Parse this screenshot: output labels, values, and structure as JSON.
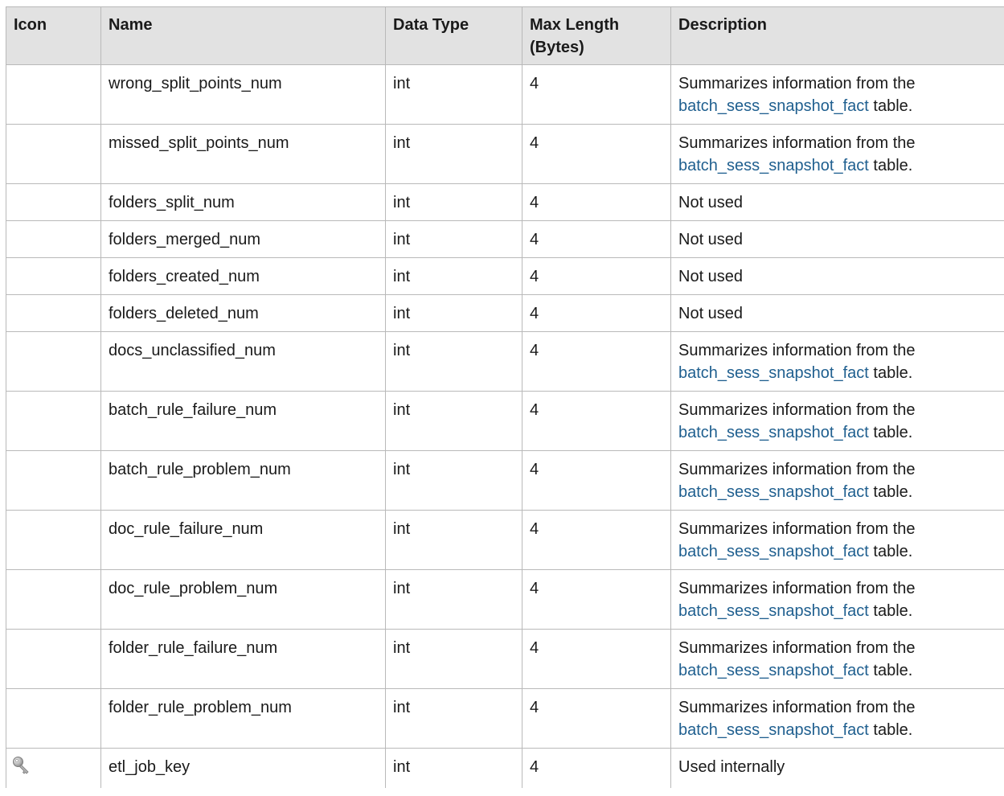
{
  "columns": [
    "Icon",
    "Name",
    "Data Type",
    "Max Length (Bytes)",
    "Description"
  ],
  "header": {
    "icon": "Icon",
    "name": "Name",
    "data_type": "Data Type",
    "max_length_line1": "Max Length",
    "max_length_line2": "(Bytes)",
    "description": "Description"
  },
  "rows": [
    {
      "icon": "",
      "name": "wrong_split_points_num",
      "type": "int",
      "length": "4",
      "desc_prefix": "Summarizes information from the",
      "desc_link": "batch_sess_snapshot_fact",
      "desc_suffix": " table."
    },
    {
      "icon": "",
      "name": "missed_split_points_num",
      "type": "int",
      "length": "4",
      "desc_prefix": "Summarizes information from the",
      "desc_link": "batch_sess_snapshot_fact",
      "desc_suffix": " table."
    },
    {
      "icon": "",
      "name": "folders_split_num",
      "type": "int",
      "length": "4",
      "desc_text": "Not used"
    },
    {
      "icon": "",
      "name": "folders_merged_num",
      "type": "int",
      "length": "4",
      "desc_text": "Not used"
    },
    {
      "icon": "",
      "name": "folders_created_num",
      "type": "int",
      "length": "4",
      "desc_text": "Not used"
    },
    {
      "icon": "",
      "name": "folders_deleted_num",
      "type": "int",
      "length": "4",
      "desc_text": "Not used"
    },
    {
      "icon": "",
      "name": "docs_unclassified_num",
      "type": "int",
      "length": "4",
      "desc_prefix": "Summarizes information from the",
      "desc_link": "batch_sess_snapshot_fact",
      "desc_suffix": " table."
    },
    {
      "icon": "",
      "name": "batch_rule_failure_num",
      "type": "int",
      "length": "4",
      "desc_prefix": "Summarizes information from the",
      "desc_link": "batch_sess_snapshot_fact",
      "desc_suffix": " table."
    },
    {
      "icon": "",
      "name": "batch_rule_problem_num",
      "type": "int",
      "length": "4",
      "desc_prefix": "Summarizes information from the",
      "desc_link": "batch_sess_snapshot_fact",
      "desc_suffix": " table."
    },
    {
      "icon": "",
      "name": "doc_rule_failure_num",
      "type": "int",
      "length": "4",
      "desc_prefix": "Summarizes information from the",
      "desc_link": "batch_sess_snapshot_fact",
      "desc_suffix": " table."
    },
    {
      "icon": "",
      "name": "doc_rule_problem_num",
      "type": "int",
      "length": "4",
      "desc_prefix": "Summarizes information from the",
      "desc_link": "batch_sess_snapshot_fact",
      "desc_suffix": " table."
    },
    {
      "icon": "",
      "name": "folder_rule_failure_num",
      "type": "int",
      "length": "4",
      "desc_prefix": "Summarizes information from the",
      "desc_link": "batch_sess_snapshot_fact",
      "desc_suffix": " table."
    },
    {
      "icon": "",
      "name": "folder_rule_problem_num",
      "type": "int",
      "length": "4",
      "desc_prefix": "Summarizes information from the",
      "desc_link": "batch_sess_snapshot_fact",
      "desc_suffix": " table."
    },
    {
      "icon": "key-icon",
      "name": "etl_job_key",
      "type": "int",
      "length": "4",
      "desc_text": "Used internally"
    }
  ],
  "colors": {
    "header_bg": "#e2e2e2",
    "border": "#b9b9b9",
    "link": "#1f5f8f",
    "text": "#1a1a1a"
  }
}
